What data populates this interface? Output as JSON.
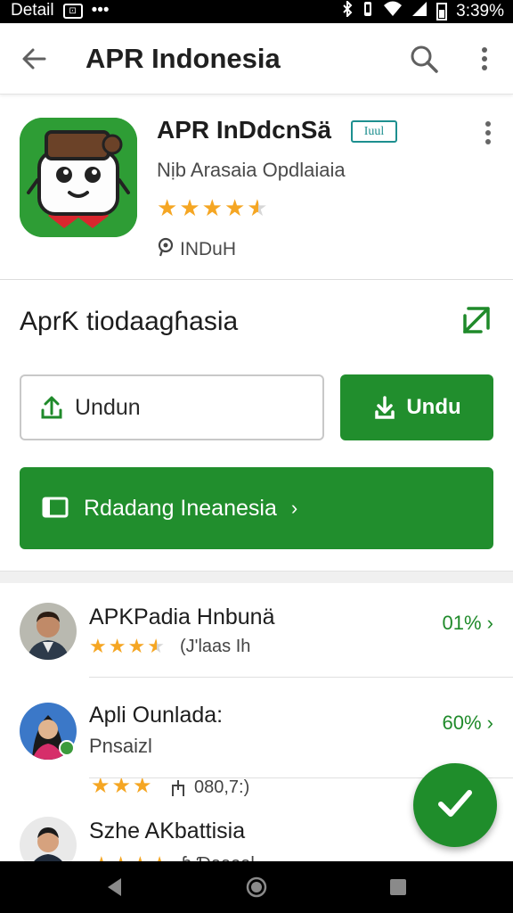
{
  "status_bar": {
    "label": "Detail",
    "box_icon_text": "⊡",
    "dots": "•••",
    "time": "3:39%"
  },
  "toolbar": {
    "title": "APR Indonesia",
    "icons": [
      "back-arrow-icon",
      "search-icon",
      "more-vert-icon"
    ]
  },
  "app": {
    "name": "APR InDdcnSä",
    "badge": "Iuul",
    "subtitle": "Nịb Arasaia Opdlaiaia",
    "rating_stars": 4.5,
    "tag": "INDuH"
  },
  "download_section": {
    "title": "AprƘ tiodaagɦasia",
    "outline_button_label": "Undun",
    "filled_button_label": "Undu",
    "wide_button_label": "Rdadang Ineanesia",
    "wide_button_chevron": "›"
  },
  "list": [
    {
      "name": "APKPadia Hnbunä",
      "meta": "(J'laas Ih",
      "rating_stars": 3.5,
      "percent": "01% ›"
    },
    {
      "name": "Apli Ounlada:",
      "sub": "Pnsaizl",
      "meta": "080,7:)",
      "rating_stars": 3,
      "percent": "60% ›"
    },
    {
      "name": "Szhe AKbattisia",
      "meta": "ɓ Ɗaaeal"
    }
  ],
  "colors": {
    "primary_green": "#218e2d",
    "star": "#f5a623",
    "percent_text": "#1f8a2a",
    "badge_teal": "#1d8f8f"
  }
}
